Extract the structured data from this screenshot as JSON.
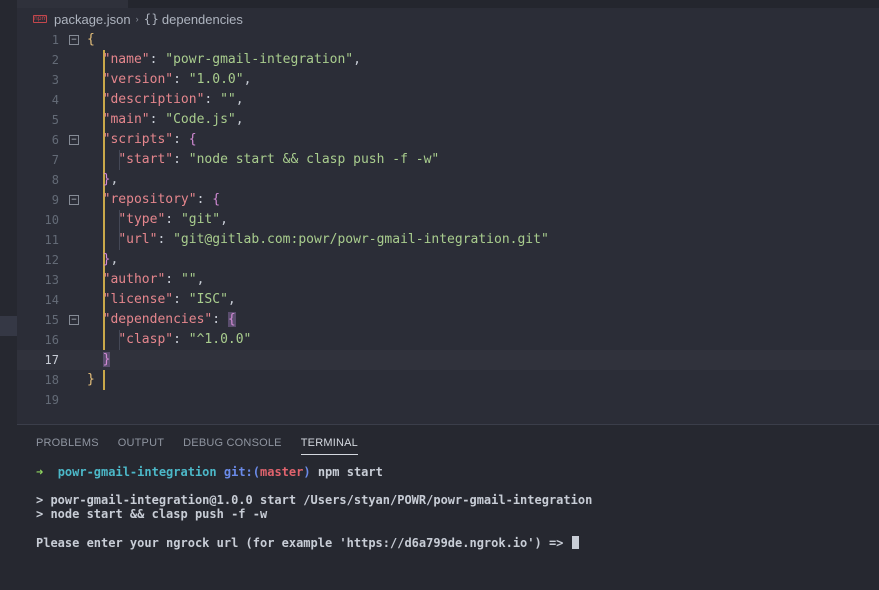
{
  "breadcrumb": {
    "file_icon": "npm-icon",
    "file_icon_text": "npm",
    "file": "package.json",
    "separator": "›",
    "symbol_icon": "{}",
    "symbol": "dependencies"
  },
  "editor": {
    "current_line": 17,
    "lines": [
      {
        "num": "1",
        "fold": "−"
      },
      {
        "num": "2"
      },
      {
        "num": "3"
      },
      {
        "num": "4"
      },
      {
        "num": "5"
      },
      {
        "num": "6",
        "fold": "−"
      },
      {
        "num": "7"
      },
      {
        "num": "8"
      },
      {
        "num": "9",
        "fold": "−"
      },
      {
        "num": "10"
      },
      {
        "num": "11"
      },
      {
        "num": "12"
      },
      {
        "num": "13"
      },
      {
        "num": "14"
      },
      {
        "num": "15",
        "fold": "−"
      },
      {
        "num": "16"
      },
      {
        "num": "17"
      },
      {
        "num": "18"
      },
      {
        "num": "19"
      }
    ],
    "code": {
      "open_brace": "{",
      "close_brace": "}",
      "name_key": "\"name\"",
      "name_val": "\"powr-gmail-integration\"",
      "version_key": "\"version\"",
      "version_val": "\"1.0.0\"",
      "description_key": "\"description\"",
      "description_val": "\"\"",
      "main_key": "\"main\"",
      "main_val": "\"Code.js\"",
      "scripts_key": "\"scripts\"",
      "start_key": "\"start\"",
      "start_val": "\"node start && clasp push -f -w\"",
      "repository_key": "\"repository\"",
      "type_key": "\"type\"",
      "type_val": "\"git\"",
      "url_key": "\"url\"",
      "url_val": "\"git@gitlab.com:powr/powr-gmail-integration.git\"",
      "author_key": "\"author\"",
      "author_val": "\"\"",
      "license_key": "\"license\"",
      "license_val": "\"ISC\"",
      "dependencies_key": "\"dependencies\"",
      "clasp_key": "\"clasp\"",
      "clasp_val": "\"^1.0.0\""
    }
  },
  "panel": {
    "tabs": [
      "PROBLEMS",
      "OUTPUT",
      "DEBUG CONSOLE",
      "TERMINAL"
    ],
    "active_tab": "TERMINAL",
    "terminal": {
      "prompt_arrow": "➜",
      "dir": "powr-gmail-integration",
      "git_label": "git:(",
      "branch": "master",
      "git_close": ")",
      "command": "npm start",
      "out1": "> powr-gmail-integration@1.0.0 start /Users/styan/POWR/powr-gmail-integration",
      "out2": "> node start && clasp push -f -w",
      "out3": "Please enter your ngrock url (for example 'https://d6a799de.ngrok.io') => "
    }
  },
  "colors": {
    "background": "#2b2d37",
    "panel": "#262830",
    "string": "#a9cd8e",
    "key": "#e5868d",
    "accent_gold": "#e6c07b"
  }
}
